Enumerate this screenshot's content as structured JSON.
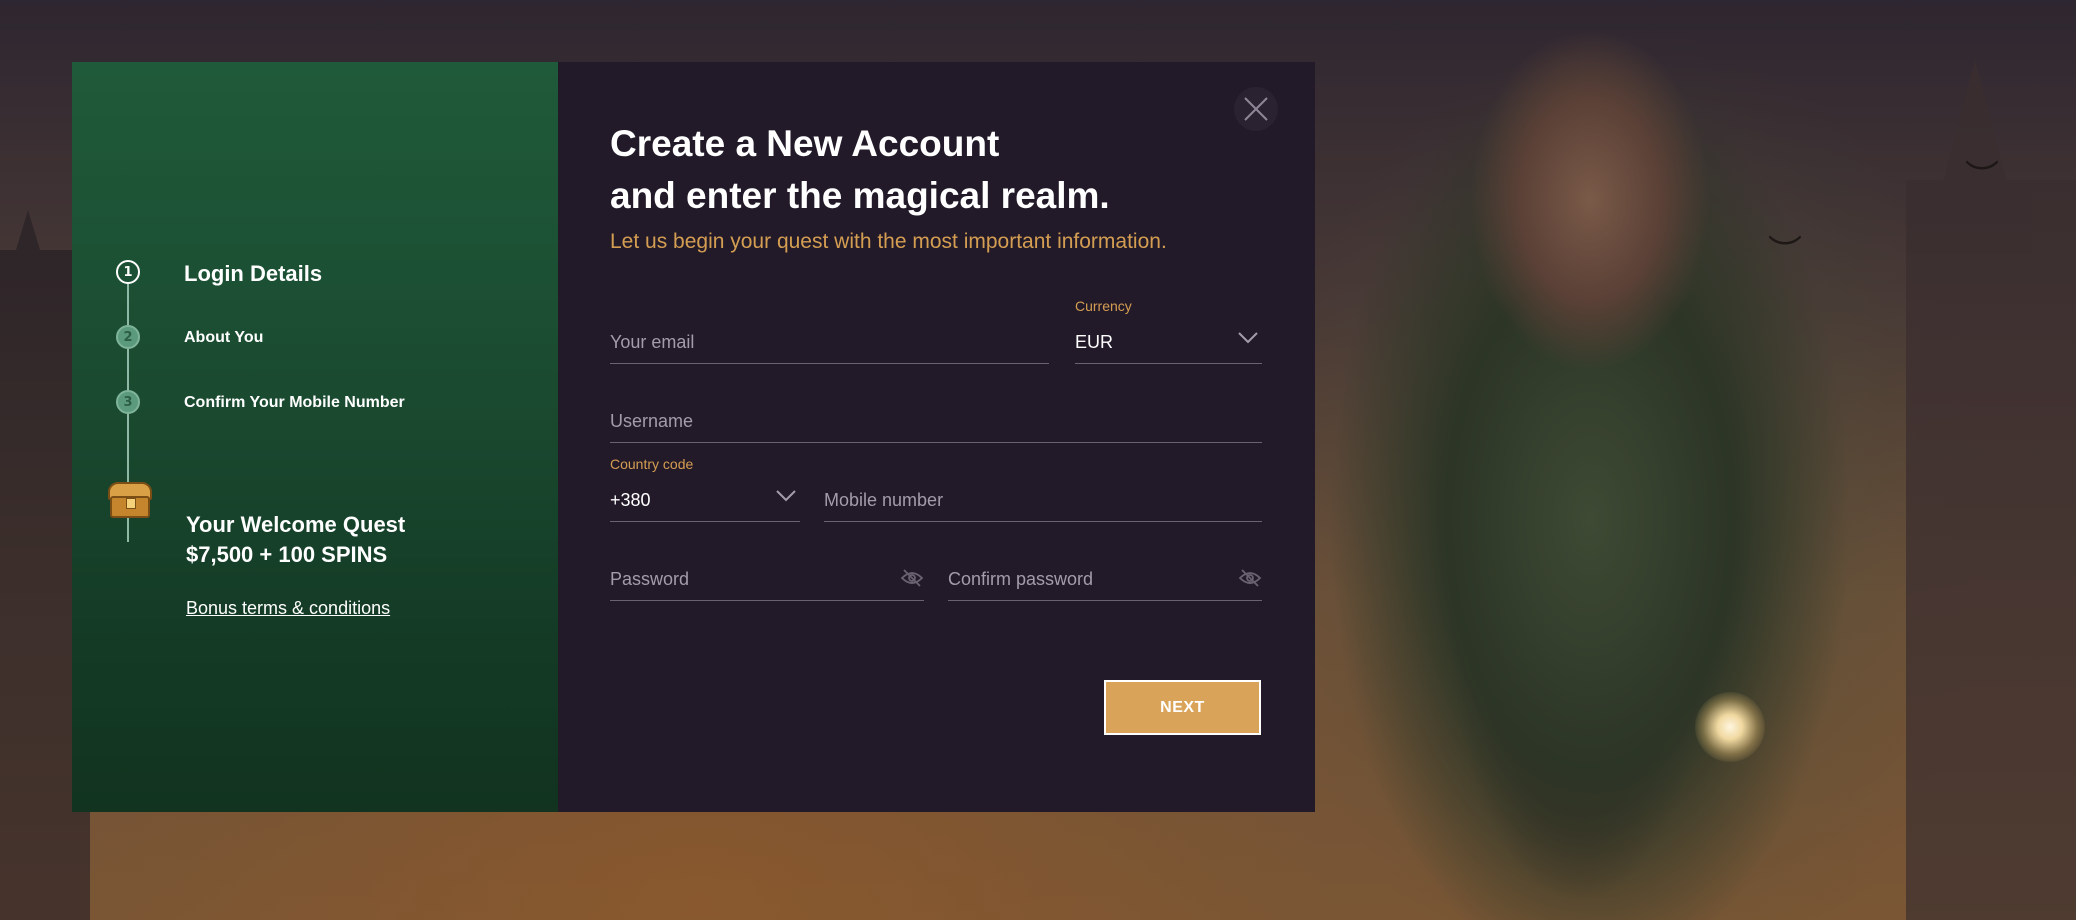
{
  "steps": [
    {
      "number": "1",
      "label": "Login Details"
    },
    {
      "number": "2",
      "label": "About You"
    },
    {
      "number": "3",
      "label": "Confirm Your Mobile Number"
    }
  ],
  "quest": {
    "title_line1": "Your Welcome Quest",
    "title_line2": "$7,500 + 100 SPINS",
    "terms_link": "Bonus terms & conditions"
  },
  "form": {
    "heading_line1": "Create a New Account",
    "heading_line2": "and enter the magical realm.",
    "subheading": "Let us begin your quest with the most important information.",
    "email_placeholder": "Your email",
    "currency_label": "Currency",
    "currency_value": "EUR",
    "username_placeholder": "Username",
    "country_code_label": "Country code",
    "country_code_value": "+380",
    "mobile_placeholder": "Mobile number",
    "password_placeholder": "Password",
    "confirm_password_placeholder": "Confirm password",
    "next_button": "NEXT"
  },
  "icons": {
    "close": "close-icon",
    "chevron": "chevron-down-icon",
    "eye_off": "eye-off-icon",
    "chest": "treasure-chest-icon"
  },
  "colors": {
    "accent": "#d9a45a",
    "panel_green": "#1a4a30",
    "panel_dark": "#231a29"
  }
}
